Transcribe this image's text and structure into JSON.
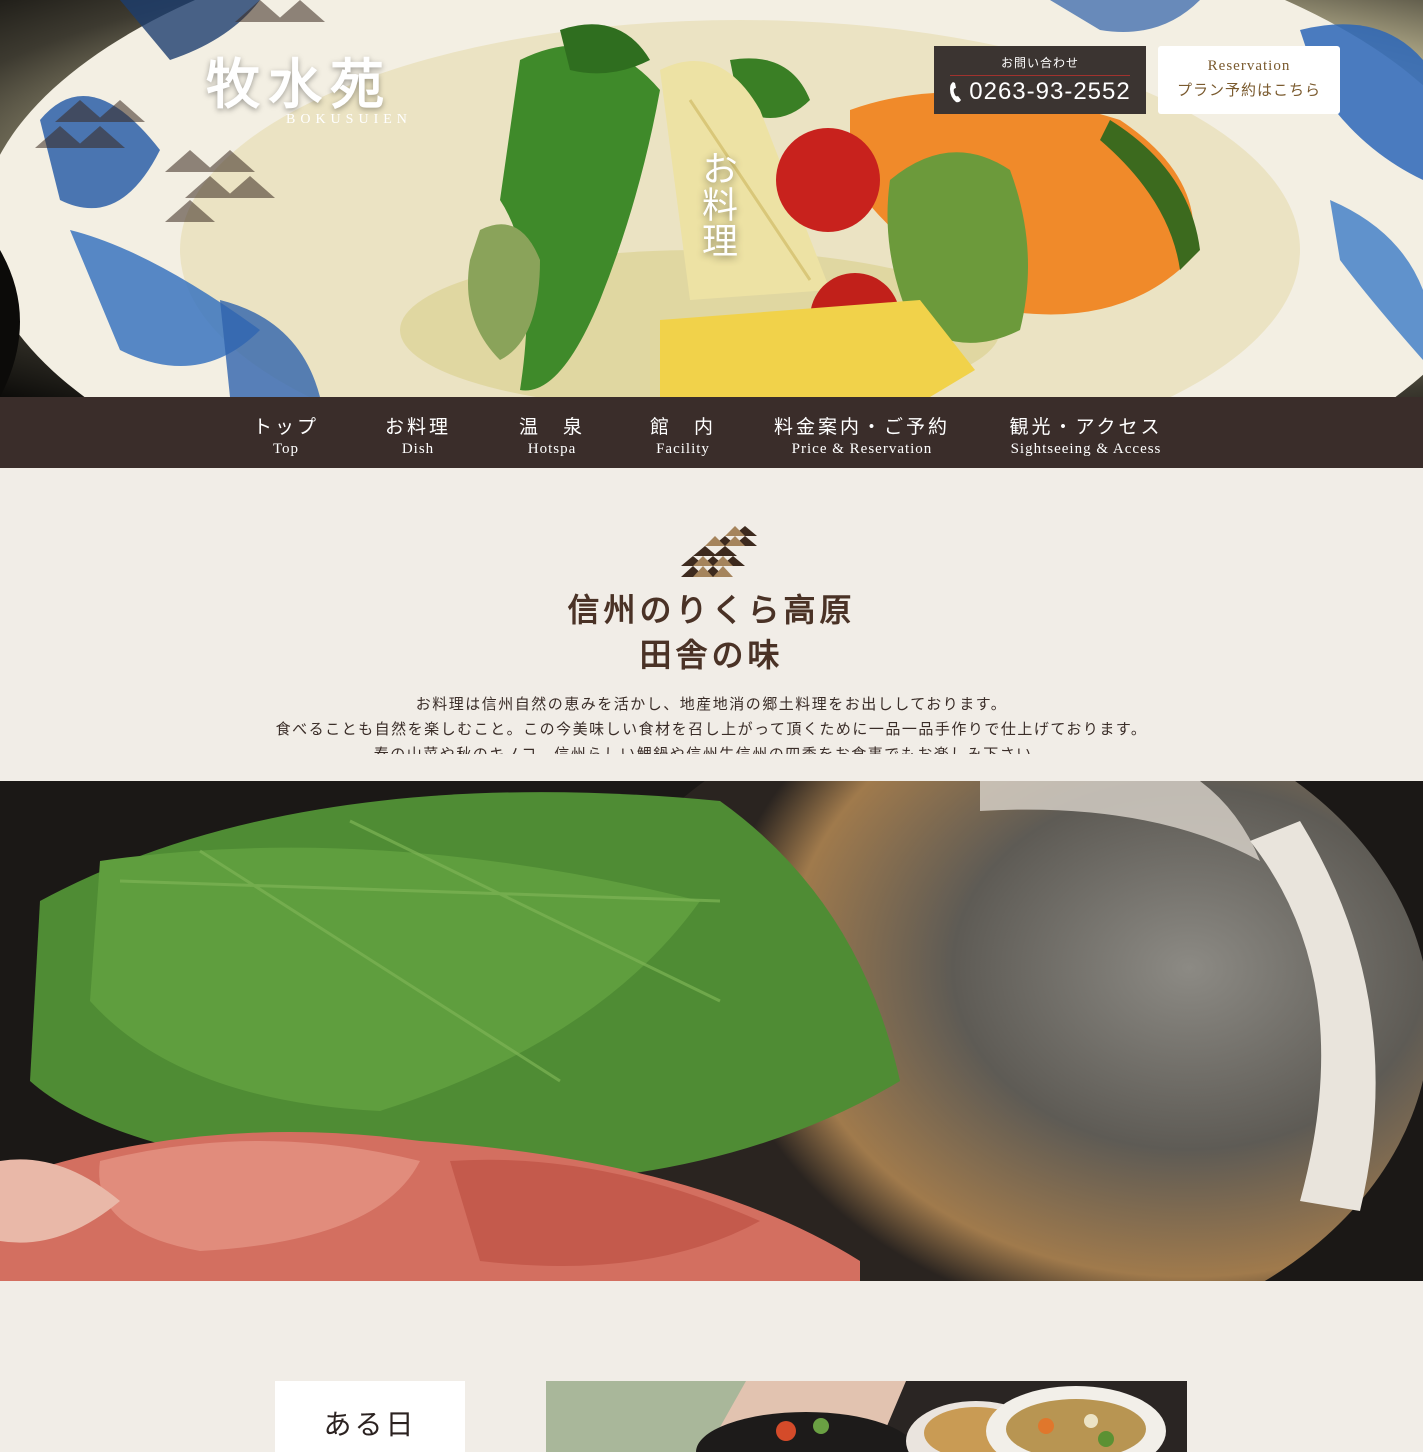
{
  "header": {
    "logo_main": "牧水苑",
    "logo_sub": "BOKUSUIEN",
    "hero_vertical_text": "お料理",
    "contact": {
      "label": "お問い合わせ",
      "phone": "0263-93-2552"
    },
    "reservation": {
      "label_en": "Reservation",
      "label_ja": "プラン予約はこちら"
    }
  },
  "nav": {
    "items": [
      {
        "ja": "トップ",
        "en": "Top"
      },
      {
        "ja": "お料理",
        "en": "Dish"
      },
      {
        "ja": "温　泉",
        "en": "Hotspa"
      },
      {
        "ja": "館　内",
        "en": "Facility"
      },
      {
        "ja": "料金案内・ご予約",
        "en": "Price & Reservation"
      },
      {
        "ja": "観光・アクセス",
        "en": "Sightseeing & Access"
      }
    ]
  },
  "intro": {
    "title_line1": "信州のりくら高原",
    "title_line2": "田舎の味",
    "text_line1": "お料理は信州自然の恵みを活かし、地産地消の郷土料理をお出ししております。",
    "text_line2": "食べることも自然を楽しむこと。この今美味しい食材を召し上がって頂くために一品一品手作りで仕上げております。",
    "text_line3": "春の山菜や秋のキノコ、信州らしい鯉鍋や信州牛信州の四季をお食事でもお楽しみ下さい。"
  },
  "section": {
    "card_title": "ある日"
  },
  "colors": {
    "nav_bg": "#3a2d2a",
    "page_bg": "#f1ede7",
    "contact_bg": "#3b3431",
    "accent_red": "#a0322e",
    "reserve_text": "#7a5a2e"
  }
}
